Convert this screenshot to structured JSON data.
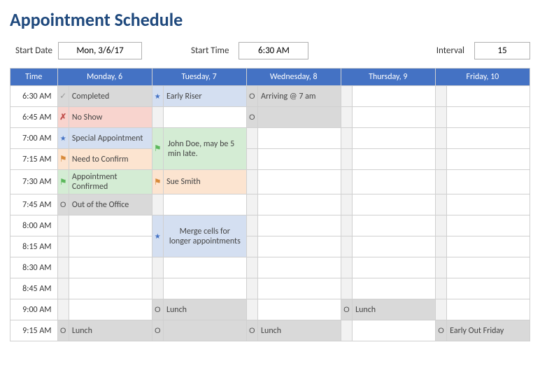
{
  "title": "Appointment Schedule",
  "controls": {
    "start_date_label": "Start Date",
    "start_date": "Mon, 3/6/17",
    "start_time_label": "Start Time",
    "start_time": "6:30 AM",
    "interval_label": "Interval",
    "interval": "15"
  },
  "headers": {
    "time": "Time",
    "mon": "Monday, 6",
    "tue": "Tuesday, 7",
    "wed": "Wednesday, 8",
    "thu": "Thursday, 9",
    "fri": "Friday, 10"
  },
  "times": {
    "r0": "6:30 AM",
    "r1": "6:45 AM",
    "r2": "7:00 AM",
    "r3": "7:15 AM",
    "r4": "7:30 AM",
    "r5": "7:45 AM",
    "r6": "8:00 AM",
    "r7": "8:15 AM",
    "r8": "8:30 AM",
    "r9": "8:45 AM",
    "r10": "9:00 AM",
    "r11": "9:15 AM"
  },
  "cells": {
    "completed": "Completed",
    "no_show": "No Show",
    "special_appt": "Special Appointment",
    "need_confirm": "Need to Confirm",
    "appt_confirmed": "Appointment Confirmed",
    "out_of_office": "Out of the Office",
    "early_riser": "Early Riser",
    "john_doe": "John Doe, may be 5 min late.",
    "sue_smith": "Sue Smith",
    "merge_cells": "Merge cells for longer appointments",
    "arriving": "Arriving @ 7 am",
    "lunch": "Lunch",
    "early_out": "Early Out Friday"
  }
}
